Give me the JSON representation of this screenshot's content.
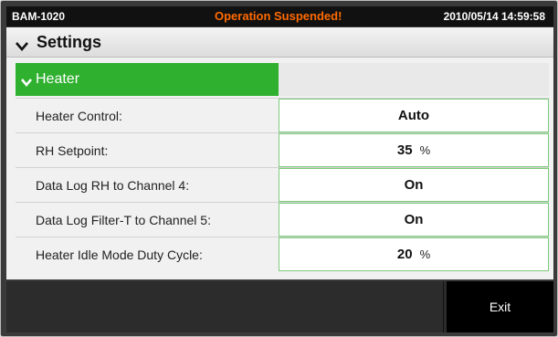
{
  "titlebar": {
    "device": "BAM-1020",
    "status": "Operation Suspended!",
    "datetime": "2010/05/14 14:59:58"
  },
  "section": {
    "title": "Settings",
    "icon": "chevron-down-icon"
  },
  "group": {
    "label": "Heater",
    "icon": "chevron-down-icon"
  },
  "rows": [
    {
      "label": "Heater Control:",
      "value": "Auto",
      "unit": ""
    },
    {
      "label": "RH Setpoint:",
      "value": "35",
      "unit": "%"
    },
    {
      "label": "Data Log RH to Channel 4:",
      "value": "On",
      "unit": ""
    },
    {
      "label": "Data Log Filter-T to Channel 5:",
      "value": "On",
      "unit": ""
    },
    {
      "label": "Heater Idle Mode Duty Cycle:",
      "value": "20",
      "unit": "%"
    }
  ],
  "footer": {
    "exit_label": "Exit"
  },
  "colors": {
    "status_text": "#ff6a00",
    "group_header": "#2fb02f",
    "value_border": "#7ccc7c"
  }
}
